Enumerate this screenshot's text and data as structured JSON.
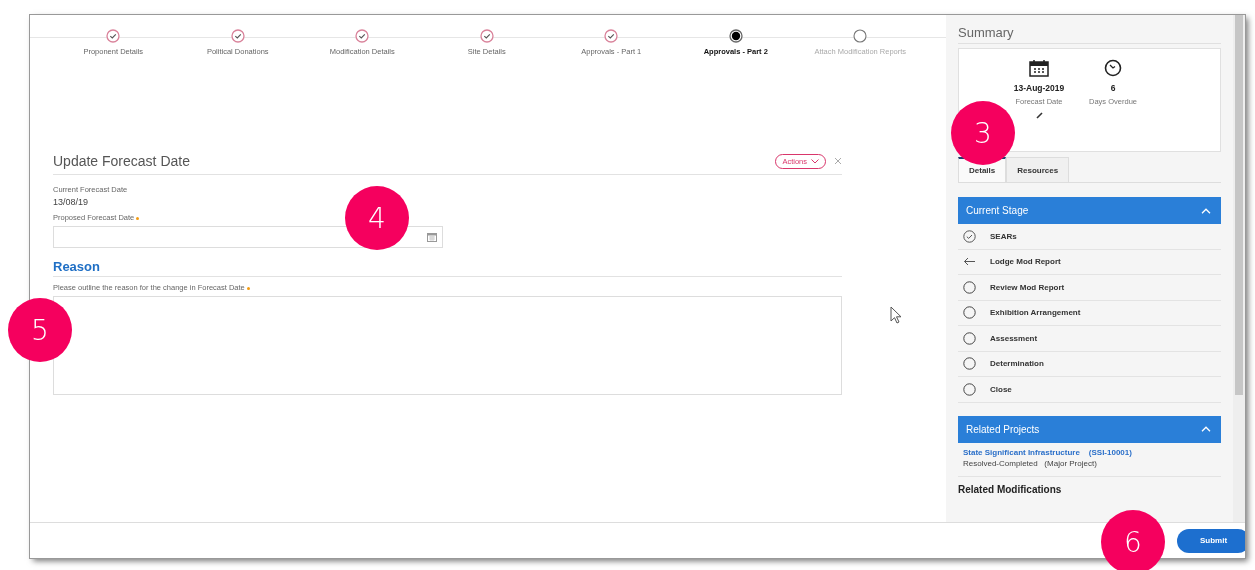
{
  "steps": [
    {
      "label": "Proponent Details",
      "done": true,
      "current": false
    },
    {
      "label": "Political Donations",
      "done": true,
      "current": false
    },
    {
      "label": "Modification Details",
      "done": true,
      "current": false
    },
    {
      "label": "Site Details",
      "done": true,
      "current": false
    },
    {
      "label": "Approvals - Part 1",
      "done": true,
      "current": false
    },
    {
      "label": "Approvals - Part 2",
      "done": false,
      "current": true
    },
    {
      "label": "Attach Modification Reports",
      "done": false,
      "current": false
    }
  ],
  "form": {
    "title": "Update Forecast Date",
    "actions_button": "Actions",
    "current_label": "Current Forecast Date",
    "current_value": "13/08/19",
    "proposed_label": "Proposed Forecast Date",
    "proposed_required": true,
    "reason_heading": "Reason",
    "reason_label": "Please outline the reason for the change in Forecast Date",
    "reason_required": true
  },
  "summary": {
    "title": "Summary",
    "forecast_date": "13-Aug-2019",
    "forecast_label": "Forecast Date",
    "days_overdue": "6",
    "overdue_label": "Days Overdue",
    "tabs": [
      {
        "label": "Details",
        "selected": true
      },
      {
        "label": "Resources",
        "selected": false
      }
    ],
    "stage_header": "Current Stage",
    "stages": [
      {
        "label": "SEARs",
        "done": true,
        "current": false
      },
      {
        "label": "Lodge Mod Report",
        "done": false,
        "current": true
      },
      {
        "label": "Review Mod Report",
        "done": false,
        "current": false
      },
      {
        "label": "Exhibition Arrangement",
        "done": false,
        "current": false
      },
      {
        "label": "Assessment",
        "done": false,
        "current": false
      },
      {
        "label": "Determination",
        "done": false,
        "current": false
      },
      {
        "label": "Close",
        "done": false,
        "current": false
      }
    ],
    "projects_header": "Related Projects",
    "project": {
      "name": "State Significant Infrastructure",
      "code": "(SSI-10001)",
      "status": "Resolved-Completed",
      "type": "(Major Project)"
    },
    "modifications_header": "Related Modifications"
  },
  "submit_button": "Submit",
  "callouts": [
    {
      "number": "3"
    },
    {
      "number": "4"
    },
    {
      "number": "5"
    },
    {
      "number": "6"
    }
  ]
}
